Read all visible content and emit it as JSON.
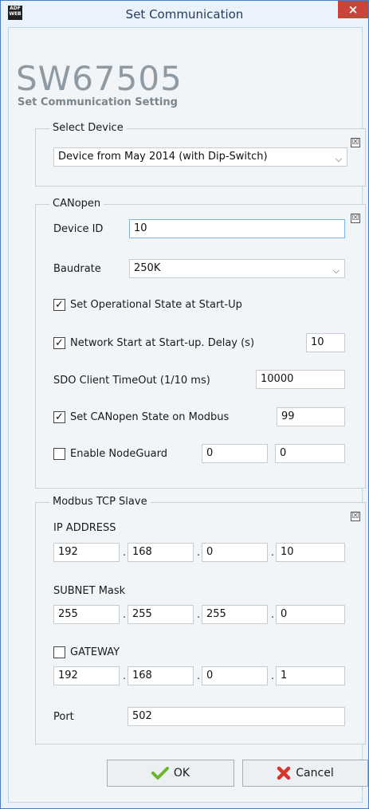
{
  "window": {
    "title": "Set Communication",
    "app_icon_text": "ADF WEB",
    "close_glyph": "×"
  },
  "brand": {
    "model": "SW67505",
    "subtitle": "Set Communication Setting"
  },
  "select_device": {
    "group_label": "Select Device",
    "collapse_glyph": "☒",
    "device_value": "Device from May 2014 (with Dip-Switch)"
  },
  "canopen": {
    "group_label": "CANopen",
    "collapse_glyph": "☒",
    "device_id_label": "Device ID",
    "device_id_value": "10",
    "baudrate_label": "Baudrate",
    "baudrate_value": "250K",
    "set_operational_label": "Set Operational State at Start-Up",
    "set_operational_checked": true,
    "network_start_label": "Network Start at Start-up. Delay (s)",
    "network_start_checked": true,
    "network_start_delay": "10",
    "sdo_timeout_label": "SDO Client TimeOut (1/10 ms)",
    "sdo_timeout_value": "10000",
    "set_canopen_state_label": "Set CANopen State on Modbus",
    "set_canopen_state_checked": true,
    "set_canopen_state_value": "99",
    "nodeguard_label": "Enable NodeGuard",
    "nodeguard_checked": false,
    "nodeguard_value_1": "0",
    "nodeguard_value_2": "0"
  },
  "modbus": {
    "group_label": "Modbus TCP Slave",
    "collapse_glyph": "☒",
    "ip_label": "IP ADDRESS",
    "ip": [
      "192",
      "168",
      "0",
      "10"
    ],
    "subnet_label": "SUBNET Mask",
    "subnet": [
      "255",
      "255",
      "255",
      "0"
    ],
    "gateway_label": "GATEWAY",
    "gateway_checked": false,
    "gateway": [
      "192",
      "168",
      "0",
      "1"
    ],
    "port_label": "Port",
    "port_value": "502"
  },
  "buttons": {
    "ok_label": "OK",
    "cancel_label": "Cancel"
  },
  "colors": {
    "accent": "#4a7bc3",
    "close": "#c9453c",
    "ok_icon": "#6bb52a",
    "cancel_icon": "#d8342b"
  },
  "check_glyph": "✓"
}
